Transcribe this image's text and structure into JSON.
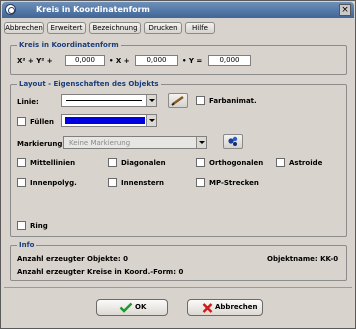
{
  "window": {
    "title": "Kreis in Koordinatenform",
    "close_label": "×"
  },
  "menu": [
    "Abbrechen",
    "Erweitert",
    "Bezeichnung",
    "Drucken",
    "Hilfe"
  ],
  "kreis": {
    "group_label": "Kreis in Koordinatenform",
    "eq_prefix": "X² + Y² +",
    "val1": "0,000",
    "eq_mid1": "• X +",
    "val2": "0,000",
    "eq_mid2": "• Y =",
    "val3": "0,000"
  },
  "layout": {
    "group_label": "Layout - Eigenschaften des Objekts",
    "linie_label": "Linie:",
    "farbanimat_label": "Farbanimat.",
    "fuellen_label": "Füllen",
    "fill_color": "#0000e0",
    "markierung_label": "Markierung:",
    "markierung_value": "Keine Markierung",
    "options_row1": [
      "Mittellinien",
      "Diagonalen",
      "Orthogonalen",
      "Astroide"
    ],
    "options_row2": [
      "Innenpolyg.",
      "Innenstern",
      "MP-Strecken"
    ],
    "ring_label": "Ring"
  },
  "info": {
    "group_label": "Info",
    "objects_label": "Anzahl erzeugter Objekte: 0",
    "objectname_label": "Objektname:  KK-0",
    "kreise_label": "Anzahl erzeugter Kreise in Koord.-Form: 0"
  },
  "buttons": {
    "ok": "OK",
    "cancel": "Abbrechen"
  },
  "colors": {
    "accent": "#1a3d7c",
    "titlebar": "#4f74a6"
  }
}
